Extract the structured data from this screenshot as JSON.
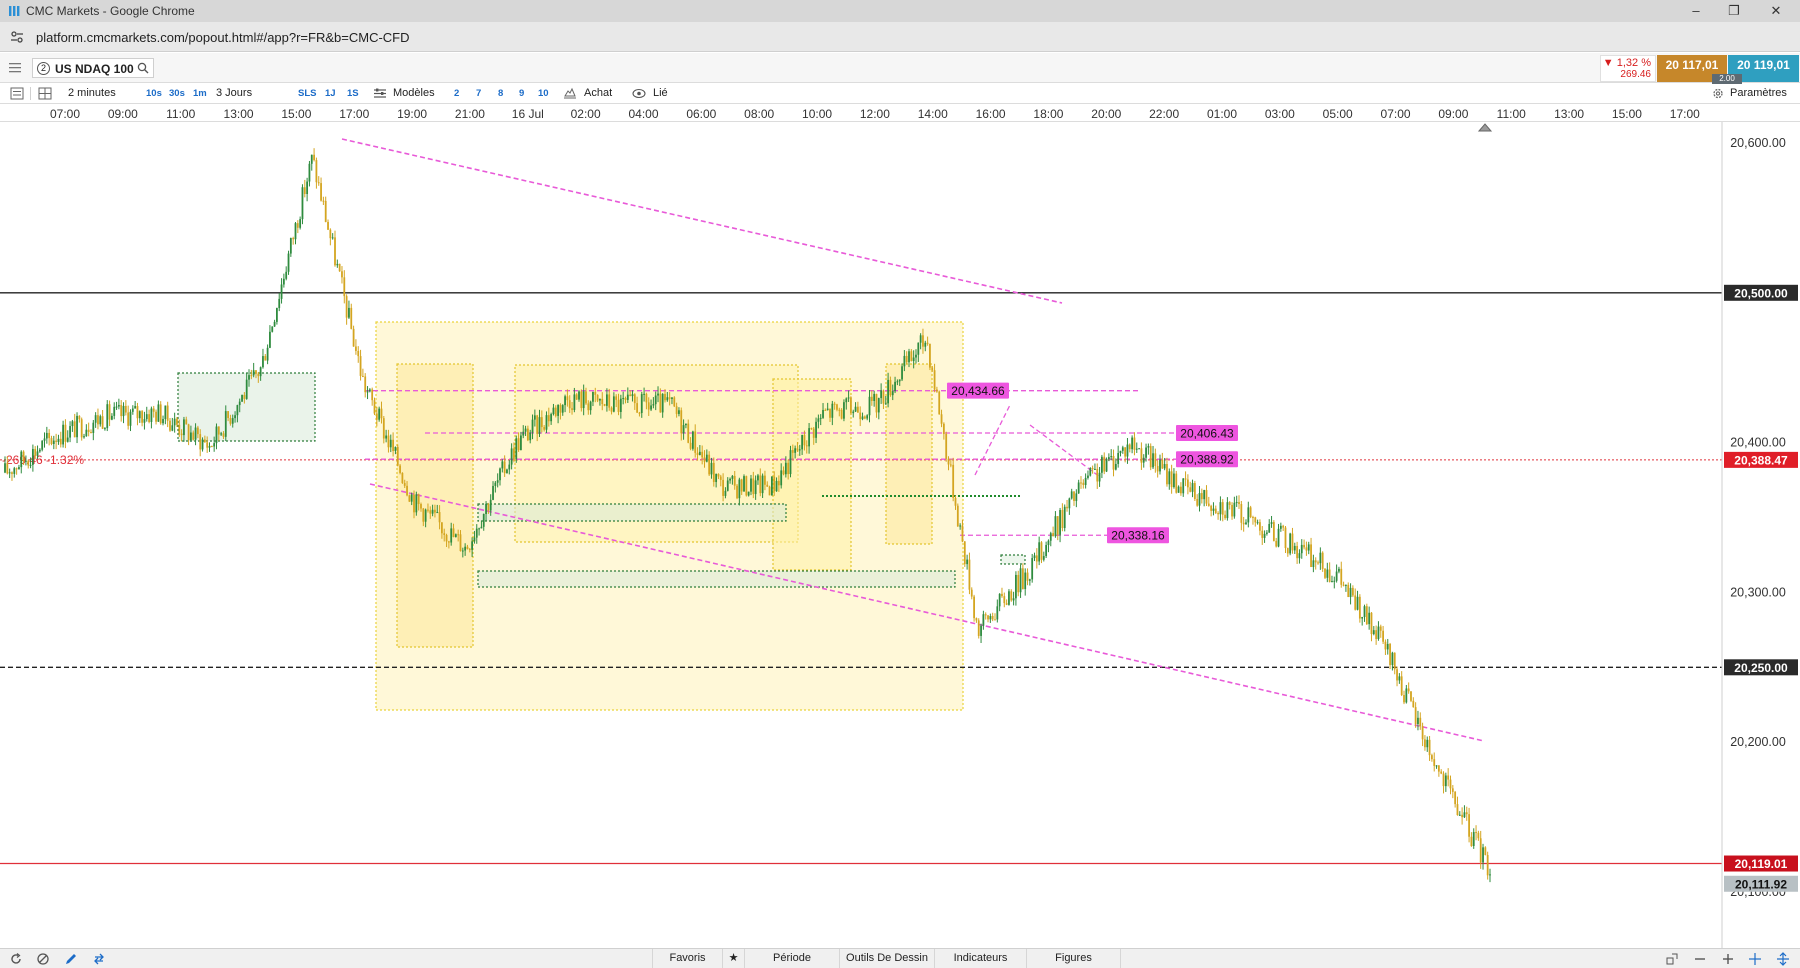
{
  "window": {
    "title": "CMC Markets - Google Chrome",
    "url": "platform.cmcmarkets.com/popout.html#/app?r=FR&b=CMC-CFD"
  },
  "instrument": {
    "count": "2",
    "name": "US NDAQ 100",
    "change_pct": "▼ 1,32 %",
    "change_pts": "269.46",
    "sell_price": "20 117,01",
    "buy_price": "20 119,01",
    "spread": "2.00"
  },
  "toolbar": {
    "interval": "2 minutes",
    "interval_presets": [
      "10s",
      "30s",
      "1m"
    ],
    "range": "3 Jours",
    "range_presets": [
      "SLS",
      "1J",
      "1S"
    ],
    "templates_label": "Modèles",
    "template_numbers": [
      "2",
      "7",
      "8",
      "9",
      "10"
    ],
    "buy_label": "Achat",
    "linked_label": "Lié",
    "settings_label": "Paramètres"
  },
  "time_axis": [
    "07:00",
    "09:00",
    "11:00",
    "13:00",
    "15:00",
    "17:00",
    "19:00",
    "21:00",
    "16 Jul",
    "02:00",
    "04:00",
    "06:00",
    "08:00",
    "10:00",
    "12:00",
    "14:00",
    "16:00",
    "18:00",
    "20:00",
    "22:00",
    "01:00",
    "03:00",
    "05:00",
    "07:00",
    "09:00",
    "11:00",
    "13:00",
    "15:00",
    "17:00"
  ],
  "price_axis": [
    "20,600.00",
    "20,400.00",
    "20,300.00",
    "20,200.00",
    "20,100.00"
  ],
  "markers": {
    "line_20500": "20,500.00",
    "line_20250": "20,250.00",
    "prev_close": "20,388.47",
    "prev_close_change": "-269.46 -1.32%",
    "current_sell": "20,119.01",
    "current_buy": "20,111.92",
    "tag_20434": "20,434.66",
    "tag_20406": "20,406.43",
    "tag_20388": "20,388.92",
    "tag_20338": "20,338.16"
  },
  "colors": {
    "bull": "#2e8b3e",
    "bear": "#d4a520",
    "trendline": "#e85ad8",
    "tag_bg": "#ee55e0",
    "prev_close": "#e0303a",
    "zone_yellow": "#fff3b8",
    "zone_green": "#d8ead8"
  },
  "chart_data": {
    "type": "candlestick",
    "instrument": "US NDAQ 100",
    "interval": "2 minutes",
    "y_range": [
      20090,
      20615
    ],
    "path": [
      [
        "07:00",
        20380
      ],
      [
        "09:00",
        20405
      ],
      [
        "11:00",
        20418
      ],
      [
        "13:00",
        20420
      ],
      [
        "15:00",
        20398
      ],
      [
        "16:00",
        20450
      ],
      [
        "17:00",
        20590
      ],
      [
        "18:00",
        20440
      ],
      [
        "19:00",
        20360
      ],
      [
        "21:00",
        20330
      ],
      [
        "22:00",
        20400
      ],
      [
        "16 Jul 02:00",
        20430
      ],
      [
        "04:00",
        20425
      ],
      [
        "06:00",
        20425
      ],
      [
        "08:00",
        20370
      ],
      [
        "10:00",
        20372
      ],
      [
        "12:00",
        20420
      ],
      [
        "14:00",
        20425
      ],
      [
        "15:10",
        20470
      ],
      [
        "16:00",
        20275
      ],
      [
        "18:00",
        20315
      ],
      [
        "20:00",
        20370
      ],
      [
        "22:00",
        20400
      ],
      [
        "01:00",
        20370
      ],
      [
        "03:00",
        20355
      ],
      [
        "05:00",
        20335
      ],
      [
        "07:00",
        20312
      ],
      [
        "08:00",
        20260
      ],
      [
        "09:00",
        20180
      ],
      [
        "09:30",
        20115
      ]
    ]
  },
  "bottom": {
    "favorites": "Favoris",
    "period": "Période",
    "drawing_tools": "Outils De Dessin",
    "indicators": "Indicateurs",
    "figures": "Figures"
  }
}
